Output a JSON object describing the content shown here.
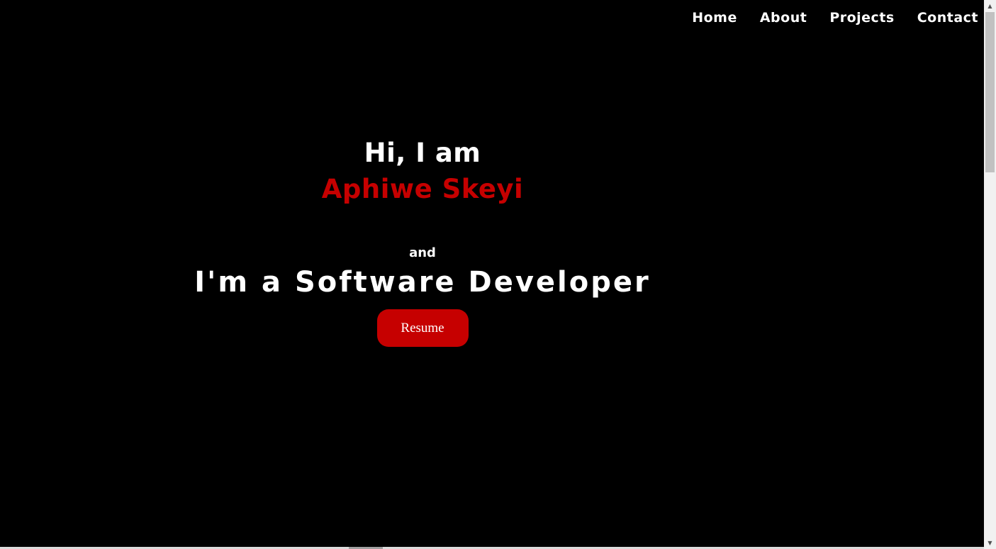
{
  "nav": {
    "items": [
      {
        "label": "Home"
      },
      {
        "label": "About"
      },
      {
        "label": "Projects"
      },
      {
        "label": "Contact"
      }
    ]
  },
  "hero": {
    "greeting": "Hi, I am",
    "name": "Aphiwe Skeyi",
    "and_text": "and",
    "role": "I'm a Software Developer",
    "resume_label": "Resume"
  },
  "colors": {
    "background": "#000000",
    "text": "#ffffff",
    "accent": "#c60000"
  },
  "icons": {
    "scroll_up": "scroll-up-arrow",
    "scroll_down": "scroll-down-arrow"
  }
}
